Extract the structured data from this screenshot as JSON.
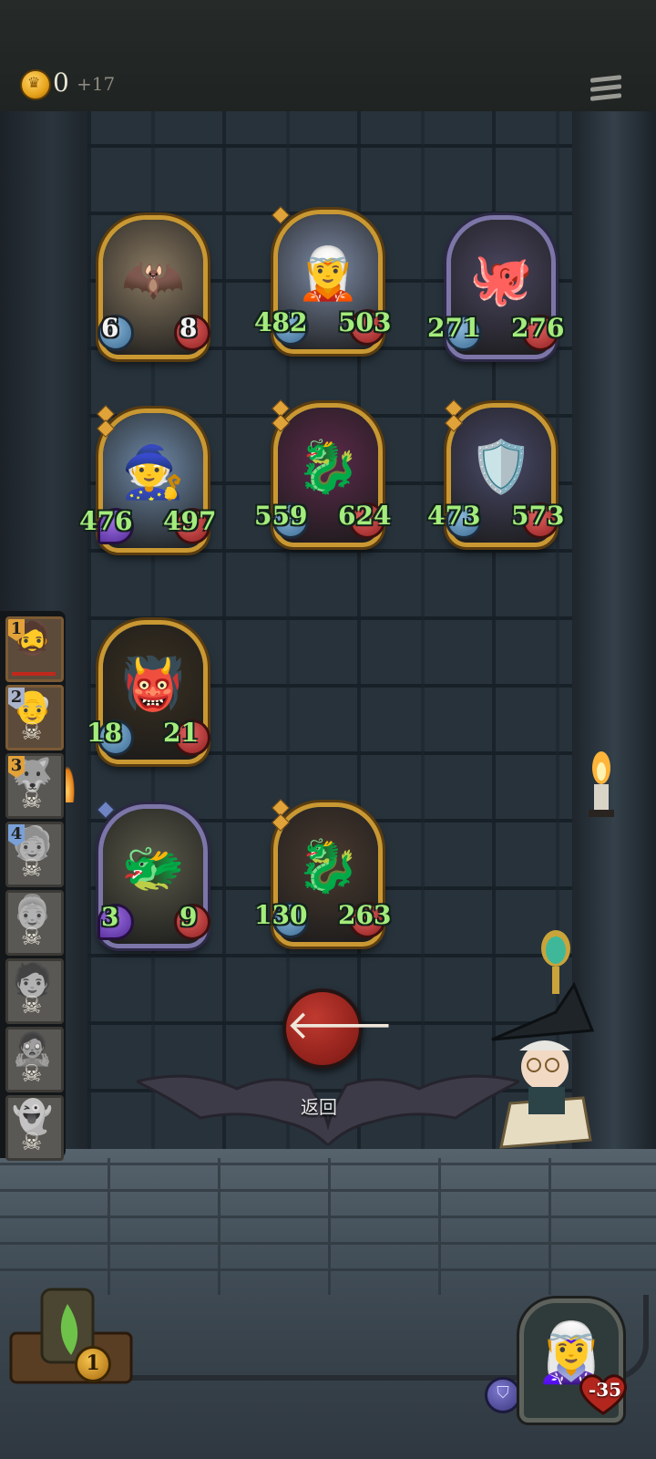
{
  "header": {
    "gold": "0",
    "gold_gain": "+17",
    "menu_icon": "menu-icon"
  },
  "board": {
    "cards": [
      {
        "name": "moth-beast",
        "emoji": "🦇",
        "attack": "6",
        "health": "8",
        "stat_color": "white",
        "frame": "gold",
        "bg": "#8a7a62"
      },
      {
        "name": "goblin-jester",
        "emoji": "🧝",
        "attack": "482",
        "health": "503",
        "stat_color": "green",
        "frame": "gold",
        "bg": "#7c8aa4"
      },
      {
        "name": "hooded-tentacle",
        "emoji": "🐙",
        "attack": "271",
        "health": "276",
        "stat_color": "green",
        "frame": "silver",
        "bg": "#4b4660"
      },
      {
        "name": "young-wizard",
        "emoji": "🧙",
        "attack": "476",
        "health": "497",
        "stat_color": "green",
        "frame": "gold",
        "bg": "#6f8aa8",
        "attack_orb": "purple"
      },
      {
        "name": "red-dragon",
        "emoji": "🐉",
        "attack": "559",
        "health": "624",
        "stat_color": "green",
        "frame": "gold",
        "bg": "#5c2a4a"
      },
      {
        "name": "armored-knight",
        "emoji": "🛡️",
        "attack": "473",
        "health": "573",
        "stat_color": "green",
        "frame": "gold",
        "bg": "#4a4a6a"
      },
      {
        "name": "golden-imp",
        "emoji": "👹",
        "attack": "18",
        "health": "21",
        "stat_color": "green",
        "frame": "gold",
        "bg": "#3a3020"
      },
      {
        "name": "bone-dragon",
        "emoji": "🐲",
        "attack": "3",
        "health": "9",
        "stat_color": "green",
        "frame": "silver",
        "bg": "#5a5a4a",
        "attack_orb": "purple"
      },
      {
        "name": "red-dragon-2",
        "emoji": "🐉",
        "attack": "130",
        "health": "263",
        "stat_color": "green",
        "frame": "gold",
        "bg": "#4a3a30"
      }
    ]
  },
  "queue": {
    "slots": [
      {
        "number": "1",
        "badge": "gold",
        "face": "🧔",
        "active": true,
        "skull": false
      },
      {
        "number": "2",
        "badge": "silver",
        "face": "👴",
        "active": true,
        "skull": true
      },
      {
        "number": "3",
        "badge": "gold",
        "face": "🐺",
        "active": false,
        "skull": true
      },
      {
        "number": "4",
        "badge": "blue",
        "face": "🧓",
        "active": false,
        "skull": true
      },
      {
        "number": "",
        "badge": "",
        "face": "👵",
        "active": false,
        "skull": true
      },
      {
        "number": "",
        "badge": "",
        "face": "🧑",
        "active": false,
        "skull": true
      },
      {
        "number": "",
        "badge": "",
        "face": "🧟",
        "active": false,
        "skull": true
      },
      {
        "number": "",
        "badge": "",
        "face": "👻",
        "active": false,
        "skull": true
      }
    ]
  },
  "back_button": {
    "icon": "arrow-left-icon",
    "label": "返回"
  },
  "deck": {
    "count": "1"
  },
  "hero": {
    "emoji": "🧝‍♀️",
    "hp": "-35"
  },
  "colors": {
    "gold_frame": "#c99832",
    "stat_green": "#a4ec7c",
    "back_red": "#c03a30"
  }
}
